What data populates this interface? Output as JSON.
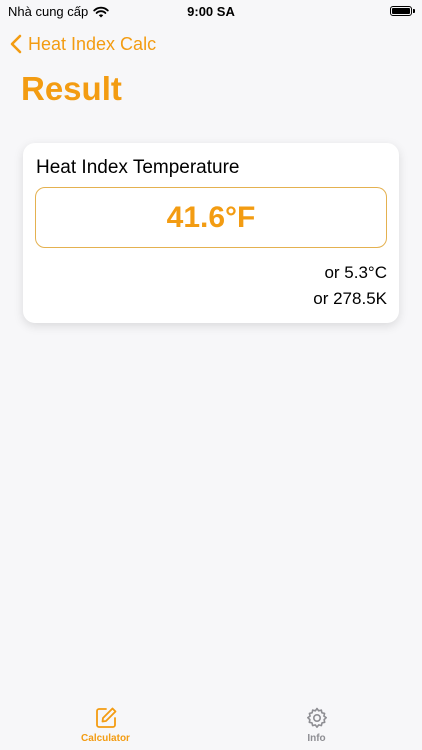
{
  "status_bar": {
    "carrier": "Nhà cung cấp",
    "time": "9:00 SA"
  },
  "nav": {
    "back_label": "Heat Index Calc"
  },
  "page": {
    "title": "Result"
  },
  "result_card": {
    "label": "Heat Index Temperature",
    "value": "41.6°F",
    "celsius": "or 5.3°C",
    "kelvin": "or 278.5K"
  },
  "tabbar": {
    "tabs": [
      {
        "label": "Calculator",
        "icon": "pencil-square-icon",
        "active": true
      },
      {
        "label": "Info",
        "icon": "gear-icon",
        "active": false
      }
    ]
  },
  "colors": {
    "accent": "#f39c12",
    "background": "#f7f7f9",
    "inactive": "#8e8e93"
  }
}
